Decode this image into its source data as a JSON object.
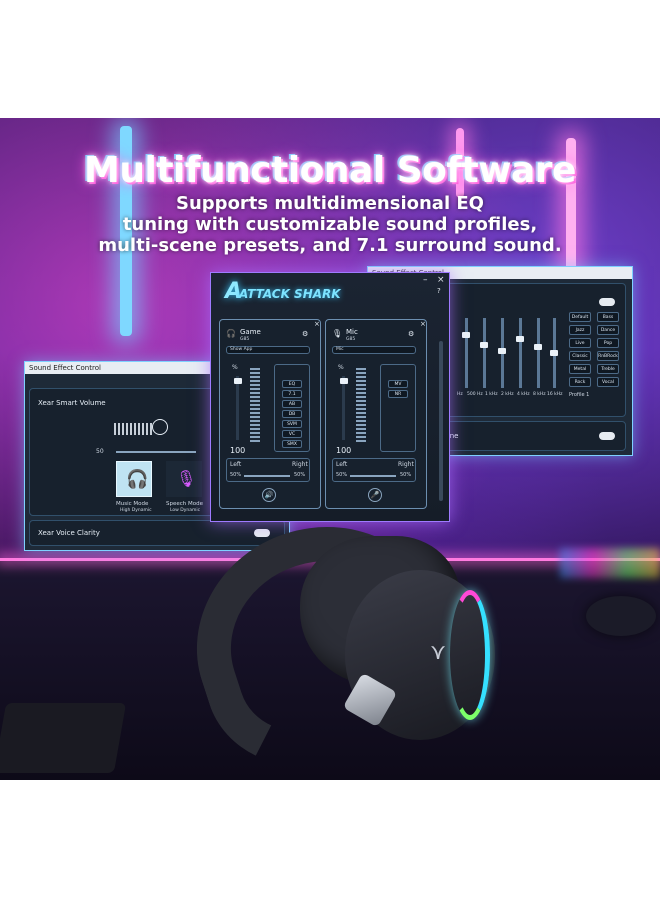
{
  "headline": "Multifunctional Software",
  "sublines": [
    "Supports multidimensional EQ",
    "tuning with customizable sound profiles,",
    "multi-scene presets, and 7.1 surround sound."
  ],
  "left_window": {
    "title": "Sound Effect Control",
    "smart_volume_label": "Xear Smart Volume",
    "slider_value": "50",
    "music_mode": {
      "label": "Music Mode",
      "sub": "High Dynamic"
    },
    "speech_mode": {
      "label": "Speech Mode",
      "sub": "Low Dynamic"
    },
    "voice_clarity_label": "Xear Voice Clarity"
  },
  "right_window": {
    "title": "Sound Effect Control",
    "presets": [
      "Default",
      "Bass",
      "Jazz",
      "Dance",
      "Live",
      "Pop",
      "Classic",
      "RnBRock",
      "Metal",
      "Treble",
      "Rock",
      "Vocal"
    ],
    "freqs": [
      "Hz",
      "500 Hz",
      "1 kHz",
      "2 kHz",
      "4 kHz",
      "8 kHz",
      "16 kHz"
    ],
    "profile_label": "Profile 1",
    "bottom_label": "hone"
  },
  "center_window": {
    "logo": "ATTACK SHARK",
    "game_panel": {
      "title": "Game",
      "sub": "G85",
      "device": "Show App",
      "pct_label": "%",
      "volume": "100",
      "eq_options": [
        "EQ",
        "7.1",
        "AB",
        "DB",
        "SVM",
        "VC",
        "SMX"
      ],
      "left_label": "Left",
      "right_label": "Right",
      "left_pct": "50%",
      "right_pct": "50%"
    },
    "mic_panel": {
      "title": "Mic",
      "sub": "G85",
      "device": "Mic",
      "pct_label": "%",
      "volume": "100",
      "options": [
        "MV",
        "NR"
      ],
      "left_label": "Left",
      "right_label": "Right",
      "left_pct": "50%",
      "right_pct": "50%"
    }
  },
  "icons": [
    "headphones-icon",
    "mic-icon",
    "gear-icon",
    "close-icon",
    "speaker-icon",
    "minimize-icon",
    "help-icon",
    "waveform-icon"
  ]
}
